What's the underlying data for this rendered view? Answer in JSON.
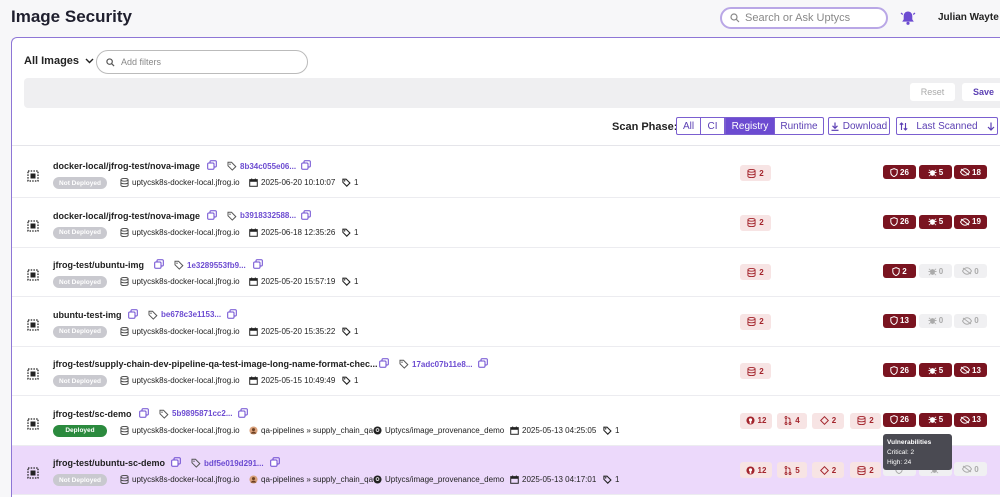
{
  "header": {
    "title": "Image Security",
    "search_placeholder": "Search or Ask Uptycs",
    "user_name": "Julian Wayte"
  },
  "toolbar": {
    "image_selector": "All Images",
    "filter_placeholder": "Add filters",
    "reset_label": "Reset",
    "save_label": "Save",
    "scan_phase_label": "Scan Phase:",
    "scan_phases": [
      "All",
      "CI",
      "Registry",
      "Runtime"
    ],
    "active_phase": "Registry",
    "download_label": "Download",
    "sort_label": "Last Scanned"
  },
  "rows": [
    {
      "name": "docker-local/jfrog-test/nova-image",
      "digest": "8b34c055e06...",
      "status": "Not Deployed",
      "registry": "uptycsk8s-docker-local.jfrog.io",
      "date": "2025-06-20 10:10:07",
      "tags": "1",
      "db": "2",
      "vuln": "26",
      "bug": "5",
      "eye": "18"
    },
    {
      "name": "docker-local/jfrog-test/nova-image",
      "digest": "b3918332588...",
      "status": "Not Deployed",
      "registry": "uptycsk8s-docker-local.jfrog.io",
      "date": "2025-06-18 12:35:26",
      "tags": "1",
      "db": "2",
      "vuln": "26",
      "bug": "5",
      "eye": "19"
    },
    {
      "name": "jfrog-test/ubuntu-img",
      "digest": "1e3289553fb9...",
      "status": "Not Deployed",
      "registry": "uptycsk8s-docker-local.jfrog.io",
      "date": "2025-05-20 15:57:19",
      "tags": "1",
      "db": "2",
      "vuln": "2",
      "bug": "0",
      "eye": "0"
    },
    {
      "name": "ubuntu-test-img",
      "digest": "be678c3e1153...",
      "status": "Not Deployed",
      "registry": "uptycsk8s-docker-local.jfrog.io",
      "date": "2025-05-20 15:35:22",
      "tags": "1",
      "db": "2",
      "vuln": "13",
      "bug": "0",
      "eye": "0"
    },
    {
      "name": "jfrog-test/supply-chain-dev-pipeline-qa-test-image-long-name-format-chec...",
      "digest": "17adc07b11e8...",
      "status": "Not Deployed",
      "registry": "uptycsk8s-docker-local.jfrog.io",
      "date": "2025-05-15 10:49:49",
      "tags": "1",
      "db": "2",
      "vuln": "26",
      "bug": "5",
      "eye": "13"
    },
    {
      "name": "jfrog-test/sc-demo",
      "digest": "5b9895871cc2...",
      "status": "Deployed",
      "registry": "uptycsk8s-docker-local.jfrog.io",
      "pipeline": "qa-pipelines » supply_chain_qa",
      "repo": "Uptycs/image_provenance_demo",
      "date": "2025-05-13 04:25:05",
      "tags": "1",
      "git": "12",
      "pr": "4",
      "diamond": "2",
      "db": "2",
      "vuln": "26",
      "bug": "5",
      "eye": "13"
    },
    {
      "name": "jfrog-test/ubuntu-sc-demo",
      "digest": "bdf5e019d291...",
      "status": "Not Deployed",
      "registry": "uptycsk8s-docker-local.jfrog.io",
      "pipeline": "qa-pipelines » supply_chain_qa",
      "repo": "Uptycs/image_provenance_demo",
      "date": "2025-05-13 04:17:01",
      "tags": "1",
      "git": "12",
      "pr": "5",
      "diamond": "2",
      "db": "2",
      "vuln": "",
      "bug": "",
      "eye": "0"
    }
  ],
  "tooltip": {
    "title": "Vulnerabilities",
    "critical": "Critical: 2",
    "high": "High: 24"
  },
  "colors": {
    "accent": "#6c4bd1",
    "vuln_dark": "#7a1420",
    "deployed": "#2b8a3e",
    "selected_row": "#ecd9fb"
  }
}
